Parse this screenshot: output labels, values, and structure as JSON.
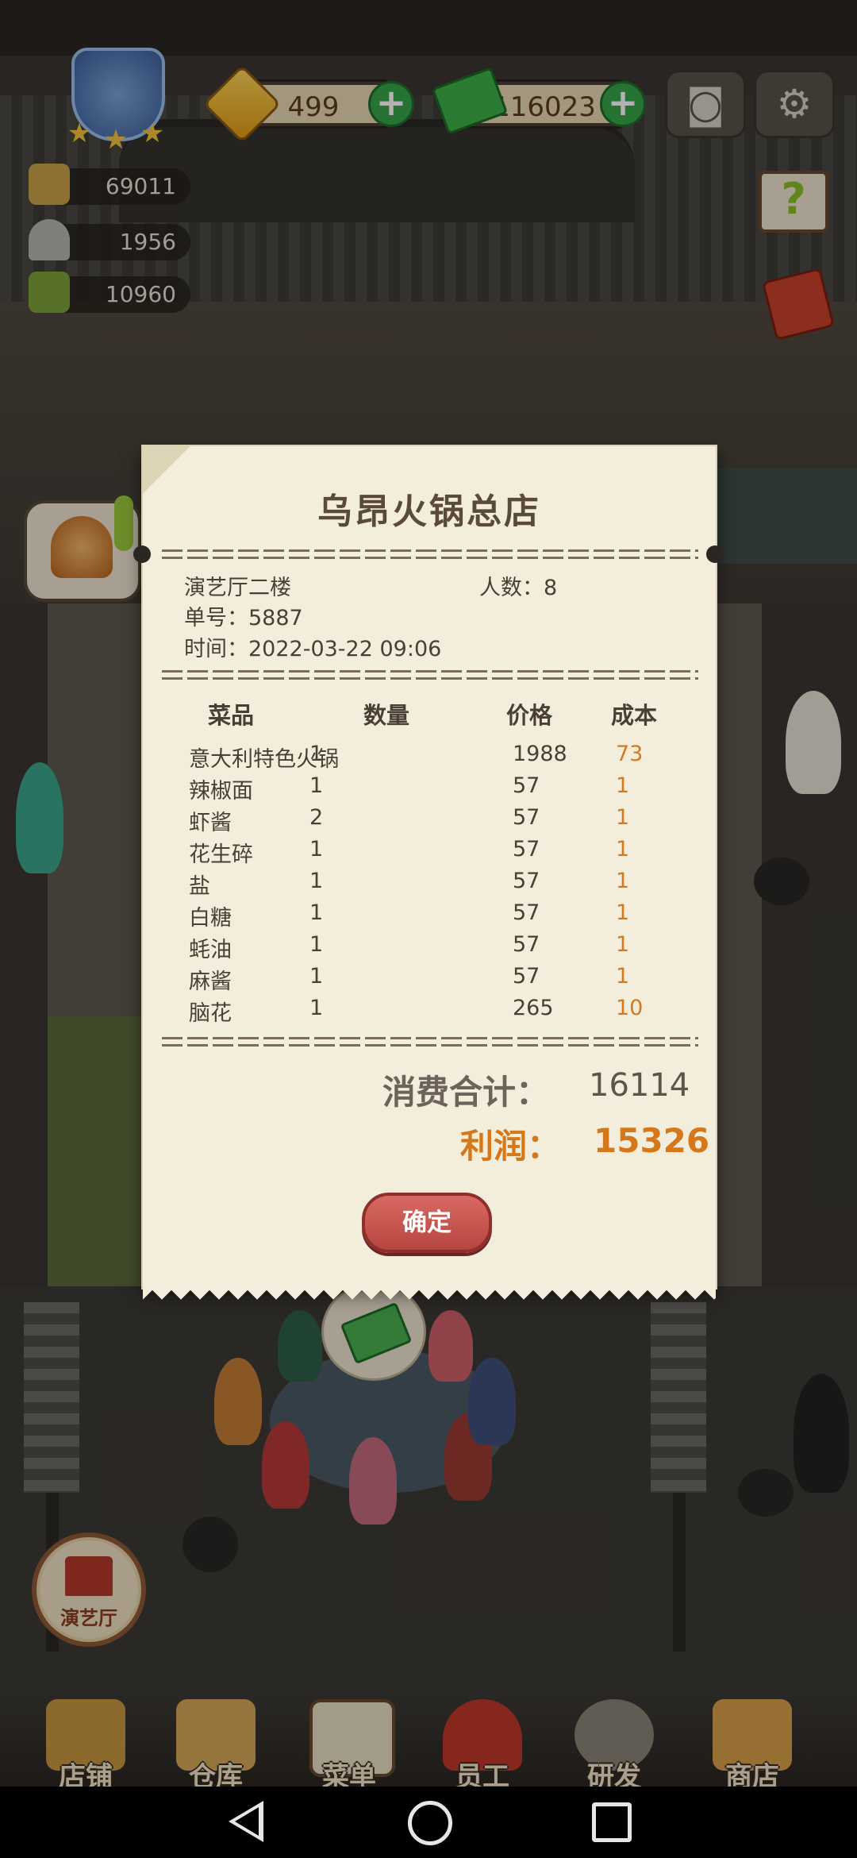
{
  "hud": {
    "diamonds": "499",
    "cash": "116023",
    "stats": [
      {
        "icon": "ingot-icon",
        "value": "69011"
      },
      {
        "icon": "cloche-icon",
        "value": "1956"
      },
      {
        "icon": "recipe-book-icon",
        "value": "10960"
      }
    ],
    "rank_stars": 3
  },
  "receipt": {
    "shop_name": "乌昂火锅总店",
    "location": "演艺厅二楼",
    "guests_label": "人数：",
    "guests": "8",
    "order_label": "单号：",
    "order_no": "5887",
    "time_label": "时间：",
    "time": "2022-03-22 09:06",
    "headers": {
      "name": "菜品",
      "qty": "数量",
      "price": "价格",
      "cost": "成本"
    },
    "items": [
      {
        "name": "意大利特色火锅",
        "qty": "1",
        "price": "1988",
        "cost": "73"
      },
      {
        "name": "辣椒面",
        "qty": "1",
        "price": "57",
        "cost": "1"
      },
      {
        "name": "虾酱",
        "qty": "2",
        "price": "57",
        "cost": "1"
      },
      {
        "name": "花生碎",
        "qty": "1",
        "price": "57",
        "cost": "1"
      },
      {
        "name": "盐",
        "qty": "1",
        "price": "57",
        "cost": "1"
      },
      {
        "name": "白糖",
        "qty": "1",
        "price": "57",
        "cost": "1"
      },
      {
        "name": "蚝油",
        "qty": "1",
        "price": "57",
        "cost": "1"
      },
      {
        "name": "麻酱",
        "qty": "1",
        "price": "57",
        "cost": "1"
      },
      {
        "name": "脑花",
        "qty": "1",
        "price": "265",
        "cost": "10"
      }
    ],
    "total_label": "消费合计：",
    "total": "16114",
    "profit_label": "利润：",
    "profit": "15326",
    "confirm_label": "确定"
  },
  "hall_button_label": "演艺厅",
  "nav": [
    {
      "label": "店铺",
      "icon": "shop-building-icon"
    },
    {
      "label": "仓库",
      "icon": "warehouse-boxes-icon"
    },
    {
      "label": "菜单",
      "icon": "menu-clipboard-icon"
    },
    {
      "label": "员工",
      "icon": "staff-icon"
    },
    {
      "label": "研发",
      "icon": "research-wok-icon"
    },
    {
      "label": "商店",
      "icon": "store-icon"
    }
  ],
  "colors": {
    "profit": "#d5781b",
    "cost": "#d27a1e",
    "confirm": "#c0504a"
  }
}
